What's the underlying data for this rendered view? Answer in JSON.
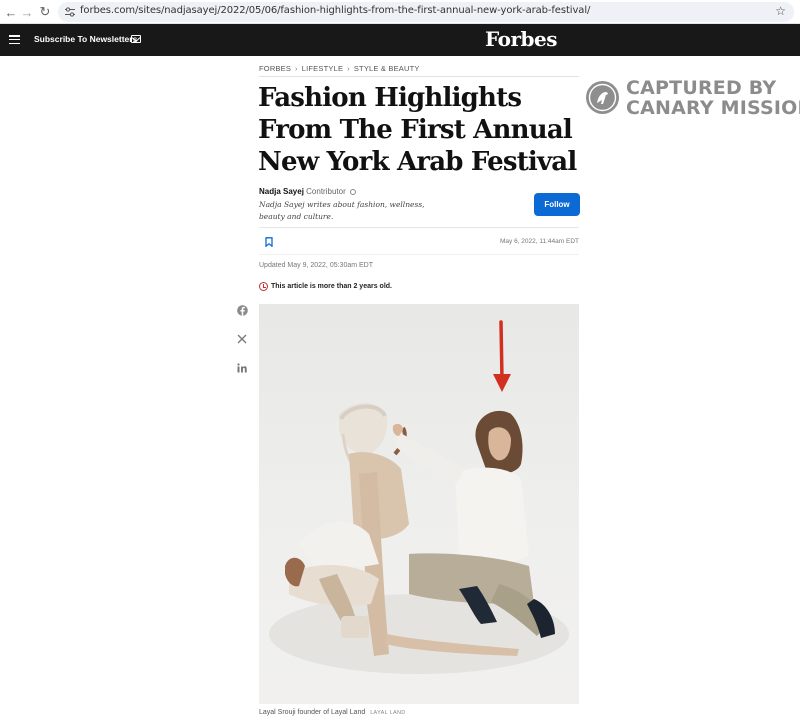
{
  "browser": {
    "url": "forbes.com/sites/nadjasayej/2022/05/06/fashion-highlights-from-the-first-annual-new-york-arab-festival/"
  },
  "header": {
    "subscribe_label": "Subscribe To Newsletters",
    "logo": "Forbes"
  },
  "article": {
    "breadcrumb": [
      "FORBES",
      "LIFESTYLE",
      "STYLE & BEAUTY"
    ],
    "title": "Fashion Highlights From The First Annual New York Arab Festival",
    "author": {
      "name": "Nadja Sayej",
      "role": "Contributor",
      "bio": "Nadja Sayej writes about fashion, wellness, beauty and culture."
    },
    "follow_label": "Follow",
    "published": "May 6, 2022, 11:44am EDT",
    "updated": "Updated May 9, 2022, 05:30am EDT",
    "age_notice": "This article is more than 2 years old.",
    "image": {
      "caption": "Layal Srouji founder of Layal Land",
      "credit": "LAYAL LAND"
    }
  },
  "share_icons": [
    "facebook-icon",
    "x-icon",
    "linkedin-icon"
  ],
  "watermark": {
    "line1": "CAPTURED BY",
    "line2": "CANARY MISSION"
  },
  "colors": {
    "header_bg": "#181818",
    "follow_button": "#0c6ad4",
    "arrow": "#d32f20",
    "watermark": "#8c8c8c"
  }
}
